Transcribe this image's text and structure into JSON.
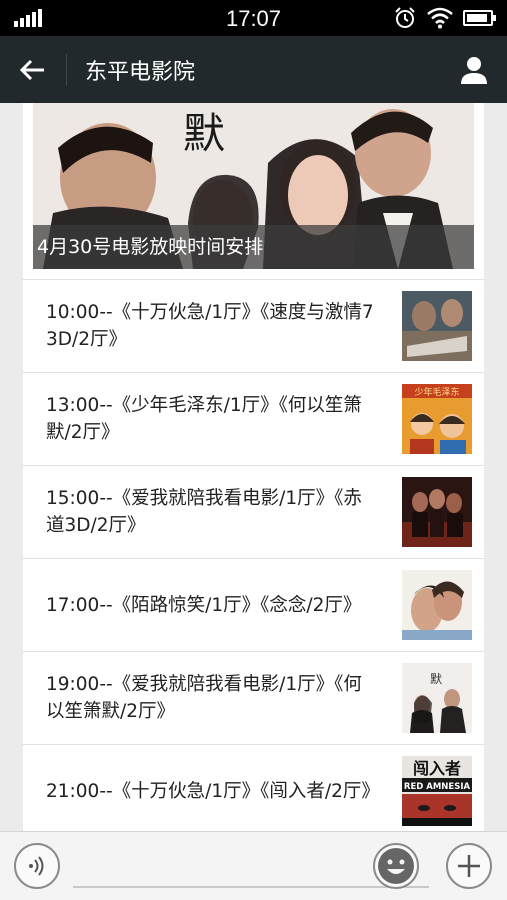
{
  "status_bar": {
    "time": "17:07"
  },
  "header": {
    "title": "东平电影院"
  },
  "banner": {
    "caption": "4月30号电影放映时间安排",
    "poster_text": "默"
  },
  "schedule": [
    {
      "text": "10:00--《十万伙急/1厅》《速度与激情7 3D/2厅》"
    },
    {
      "text": "13:00--《少年毛泽东/1厅》《何以笙箫默/2厅》"
    },
    {
      "text": "15:00--《爱我就陪我看电影/1厅》《赤道3D/2厅》"
    },
    {
      "text": "17:00--《陌路惊笑/1厅》《念念/2厅》"
    },
    {
      "text": "19:00--《爱我就陪我看电影/1厅》《何以笙箫默/2厅》"
    },
    {
      "text": "21:00--《十万伙急/1厅》《闯入者/2厅》"
    }
  ],
  "thumbs": {
    "t2_text": "少年毛泽东",
    "t6_title": "闯入者",
    "t6_sub": "RED AMNESIA"
  },
  "colors": {
    "titlebar_bg": "#21292c",
    "statusbar_bg": "#000000",
    "page_bg": "#ebebeb"
  }
}
